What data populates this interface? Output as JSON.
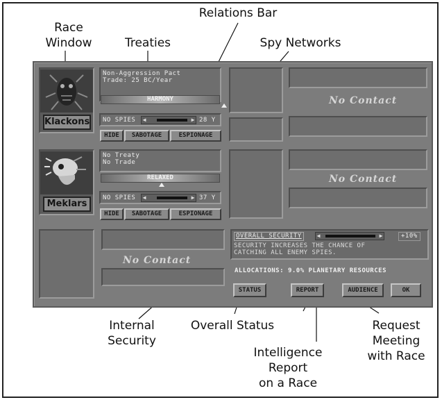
{
  "callouts": {
    "race_window": "Race\nWindow",
    "treaties": "Treaties",
    "relations_bar": "Relations Bar",
    "spy_networks": "Spy Networks",
    "internal_security": "Internal\nSecurity",
    "overall_status": "Overall Status",
    "intelligence_report": "Intelligence\nReport\non a Race",
    "request_meeting": "Request\nMeeting\nwith Race"
  },
  "races": [
    {
      "name": "Klackons",
      "treaty": "Non-Aggression Pact",
      "trade": "Trade: 25 BC/Year",
      "relation": "HARMONY",
      "relation_level": 0.95,
      "spies": "NO SPIES",
      "spy_value": "28 Y",
      "buttons": [
        "HIDE",
        "SABOTAGE",
        "ESPIONAGE"
      ]
    },
    {
      "name": "Meklars",
      "treaty": "No Treaty",
      "trade": "No Trade",
      "relation": "RELAXED",
      "relation_level": 0.5,
      "spies": "NO SPIES",
      "spy_value": "37 Y",
      "buttons": [
        "HIDE",
        "SABOTAGE",
        "ESPIONAGE"
      ]
    }
  ],
  "no_contact": "No Contact",
  "security": {
    "label": "OVERALL SECURITY",
    "value": "+10%",
    "description_1": "SECURITY INCREASES THE CHANCE OF",
    "description_2": "CATCHING ALL ENEMY SPIES.",
    "allocations": "ALLOCATIONS: 9.0% PLANETARY RESOURCES"
  },
  "actions": {
    "status": "STATUS",
    "report": "REPORT",
    "audience": "AUDIENCE",
    "ok": "OK"
  },
  "colors": {
    "panel": "#7c7c7c",
    "bevel_dark": "#4e4e4e",
    "bevel_light": "#9c9c9c"
  }
}
